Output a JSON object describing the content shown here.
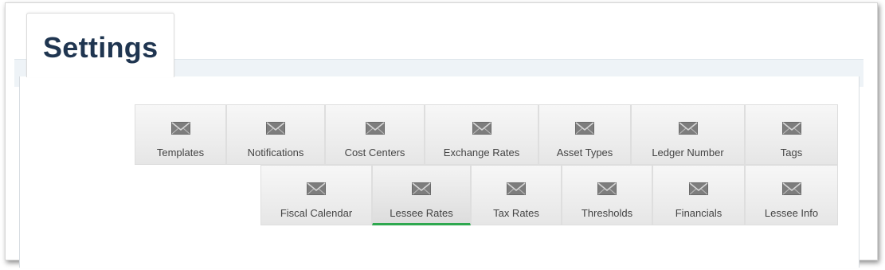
{
  "page": {
    "title": "Settings"
  },
  "tabs": [
    {
      "label": "Templates",
      "icon": "envelope-icon"
    },
    {
      "label": "Notifications",
      "icon": "envelope-icon"
    },
    {
      "label": "Cost Centers",
      "icon": "envelope-icon"
    },
    {
      "label": "Exchange Rates",
      "icon": "envelope-icon"
    },
    {
      "label": "Asset Types",
      "icon": "envelope-icon"
    },
    {
      "label": "Ledger Number",
      "icon": "envelope-icon"
    },
    {
      "label": "Tags",
      "icon": "envelope-icon"
    },
    {
      "label": "Fiscal Calendar",
      "icon": "envelope-icon"
    },
    {
      "label": "Lessee Rates",
      "icon": "envelope-icon",
      "active": true
    },
    {
      "label": "Tax Rates",
      "icon": "envelope-icon"
    },
    {
      "label": "Thresholds",
      "icon": "envelope-icon"
    },
    {
      "label": "Financials",
      "icon": "envelope-icon"
    },
    {
      "label": "Lessee Info",
      "icon": "envelope-icon"
    }
  ],
  "colors": {
    "active_indicator": "#2ea84f",
    "title": "#1f3550"
  }
}
